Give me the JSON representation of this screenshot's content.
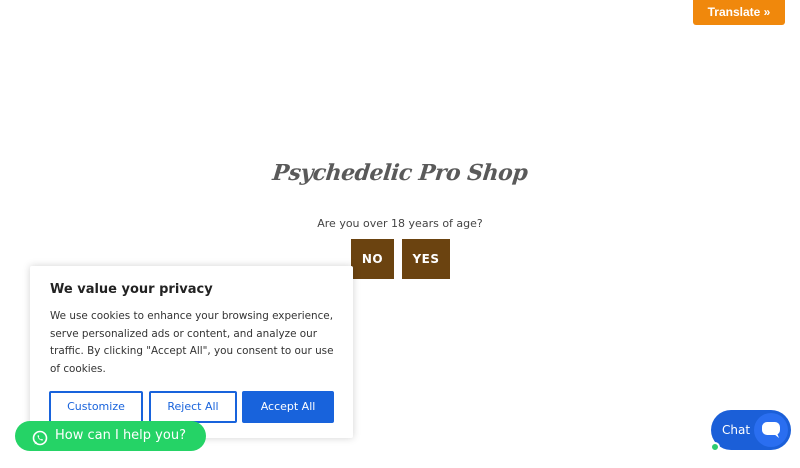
{
  "translate": {
    "label": "Translate »"
  },
  "age_gate": {
    "logo_text": "Psychedelic Pro Shop",
    "question": "Are you over 18 years of age?",
    "no_label": "NO",
    "yes_label": "YES",
    "button_color": "#6b4310"
  },
  "cookie_banner": {
    "title": "We value your privacy",
    "text": "We use cookies to enhance your browsing experience, serve personalized ads or content, and analyze our traffic. By clicking \"Accept All\", you consent to our use of cookies.",
    "customize_label": "Customize",
    "reject_label": "Reject All",
    "accept_label": "Accept All",
    "accent_color": "#1863dc"
  },
  "whatsapp": {
    "label": "How can I help you?",
    "icon": "whatsapp-icon",
    "color": "#25d366"
  },
  "chat": {
    "label": "Chat",
    "icon": "chat-bubble-icon",
    "color": "#1b5fd8"
  }
}
